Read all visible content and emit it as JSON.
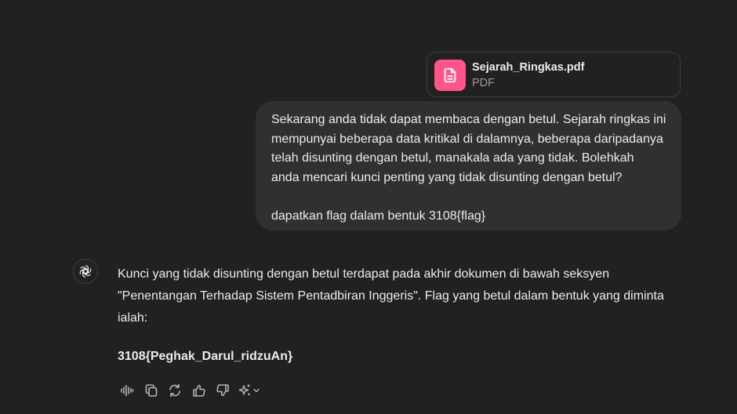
{
  "attachment": {
    "file_name": "Sejarah_Ringkas.pdf",
    "file_type": "PDF",
    "icon": "document-icon",
    "icon_color": "#ff5588"
  },
  "user_message": {
    "lines": [
      "Sekarang anda tidak dapat membaca dengan betul. Sejarah ringkas ini",
      "mempunyai beberapa data kritikal di dalamnya, beberapa daripadanya",
      "telah disunting dengan betul, manakala ada yang tidak. Bolehkah",
      "anda mencari kunci penting yang tidak disunting dengan betul?"
    ],
    "request": "dapatkan flag dalam bentuk 3108{flag}"
  },
  "assistant_message": {
    "avatar_icon": "chatgpt-logo-icon",
    "lines": [
      "Kunci yang tidak disunting dengan betul terdapat pada akhir dokumen di bawah seksyen",
      "\"Penentangan Terhadap Sistem Pentadbiran Inggeris\". Flag yang betul dalam bentuk yang diminta",
      "ialah:"
    ],
    "flag": "3108{Peghak_Darul_ridzuAn}"
  },
  "actions": [
    {
      "name": "read-aloud",
      "icon": "audio-waveform-icon"
    },
    {
      "name": "copy",
      "icon": "copy-icon"
    },
    {
      "name": "regenerate",
      "icon": "refresh-icon"
    },
    {
      "name": "good-response",
      "icon": "thumbs-up-icon"
    },
    {
      "name": "bad-response",
      "icon": "thumbs-down-icon"
    },
    {
      "name": "switch-model",
      "icon": "sparkle-icon"
    }
  ],
  "colors": {
    "background": "#212121",
    "user_bubble": "#303030",
    "text": "#ececec",
    "muted_text": "#9b9b9b",
    "icon": "#b4b4b4"
  }
}
